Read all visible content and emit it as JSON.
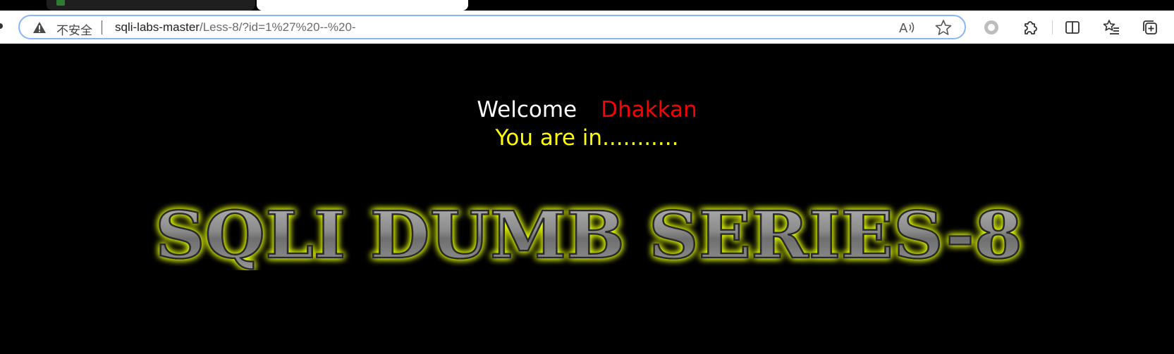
{
  "browser": {
    "address_bar": {
      "security_label": "不安全",
      "url_host": "sqli-labs-master",
      "url_path": "/Less-8/?id=1%27%20--%20-"
    },
    "icons": [
      "warning-icon",
      "read-aloud-icon",
      "favorite-star-icon",
      "extension-dot-icon",
      "extensions-icon",
      "split-screen-icon",
      "favorites-icon",
      "collections-icon"
    ]
  },
  "page": {
    "welcome_label": "Welcome",
    "user_name": "Dhakkan",
    "status_message": "You are in...........",
    "banner_text": "SQLI DUMB SERIES-8",
    "colors": {
      "background": "#000000",
      "welcome": "#ffffff",
      "user_name": "#ff0000",
      "status": "#ffff00",
      "banner_glow": "#e6ff00"
    }
  }
}
